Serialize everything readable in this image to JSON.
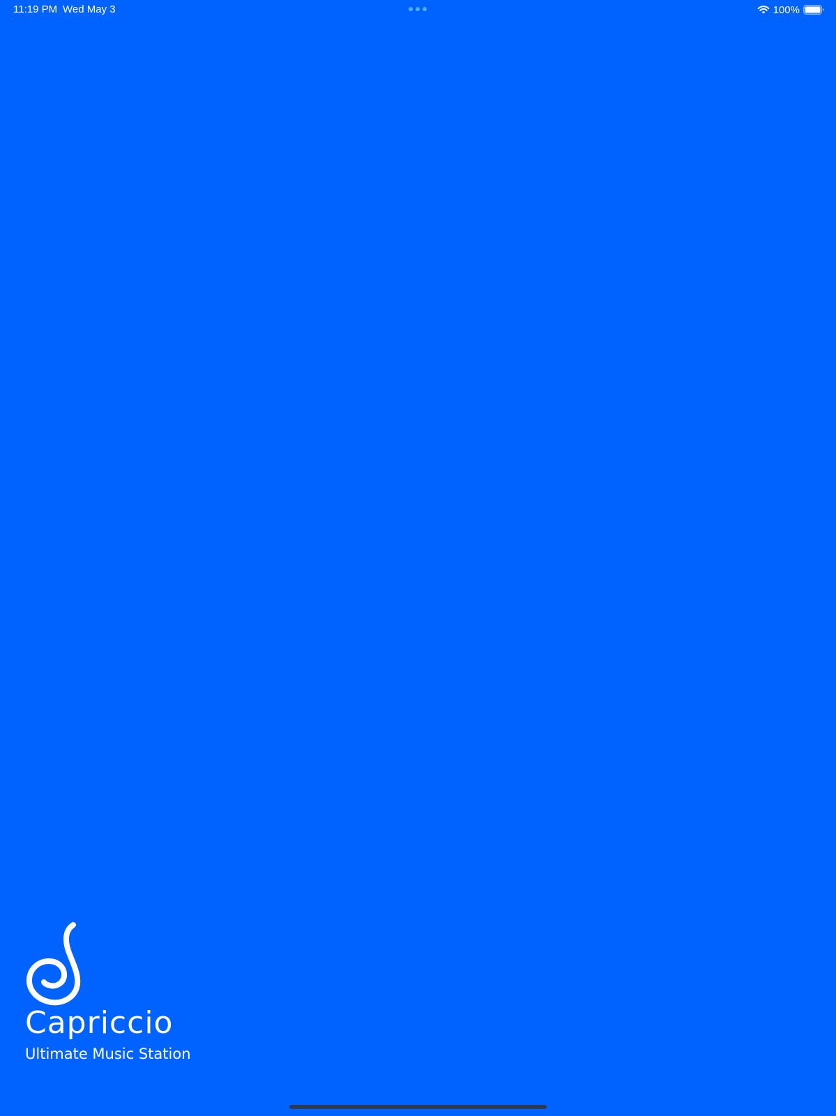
{
  "status_bar": {
    "time": "11:19 PM",
    "date": "Wed May 3",
    "battery_percent": "100%",
    "battery_level": 1.0,
    "wifi_icon": "wifi-icon",
    "battery_icon": "battery-icon",
    "multitask_icon": "ellipsis-icon"
  },
  "splash": {
    "app_name": "Capriccio",
    "tagline": "Ultimate Music Station",
    "logo_icon": "capriccio-swirl-logo"
  },
  "colors": {
    "background": "#0062FF",
    "foreground": "#FFFFFF",
    "multitask_dots": "#4FB0FF",
    "home_indicator": "#2B3A55"
  }
}
